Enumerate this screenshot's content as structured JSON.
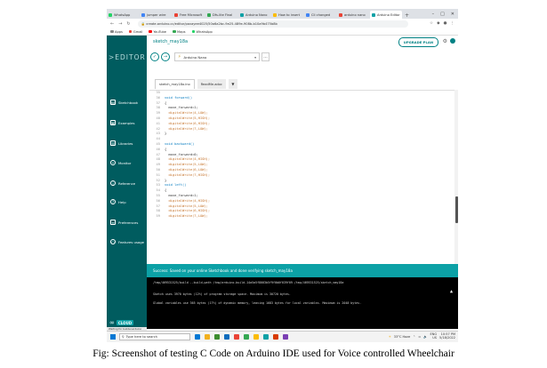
{
  "browser": {
    "tabs": [
      {
        "label": "WhatsApp",
        "color": "#25d366",
        "active": false
      },
      {
        "label": "jumper wire",
        "color": "#4285f4",
        "active": false
      },
      {
        "label": "Free Microsoft",
        "color": "#ea4335",
        "active": false
      },
      {
        "label": "Dfs-lite Final",
        "color": "#34a853",
        "active": false
      },
      {
        "label": "Arduino Nano",
        "color": "#0ca1a6",
        "active": false
      },
      {
        "label": "How to insert",
        "color": "#fbbc05",
        "active": false
      },
      {
        "label": "Cli changed",
        "color": "#4285f4",
        "active": false
      },
      {
        "label": "arduino nano",
        "color": "#ea4335",
        "active": false
      },
      {
        "label": "Arduino Editor",
        "color": "#0ca1a6",
        "active": true
      }
    ],
    "new_tab": "+",
    "url": "create.arduino.cc/editor/pavayee4025/50a6a2bc-9e25-489e-908b-b10a9b475b8b",
    "bookmarks": [
      {
        "label": "Apps",
        "color": "#888888"
      },
      {
        "label": "Gmail",
        "color": "#ea4335"
      },
      {
        "label": "YouTube",
        "color": "#ff0000"
      },
      {
        "label": "Maps",
        "color": "#34a853"
      },
      {
        "label": "WhatsApp",
        "color": "#25d366"
      }
    ]
  },
  "sidebar": {
    "logo": "EDITOR",
    "items": [
      {
        "label": "Sketchbook",
        "icon": "sketchbook-icon"
      },
      {
        "label": "Examples",
        "icon": "examples-icon"
      },
      {
        "label": "Libraries",
        "icon": "libraries-icon"
      },
      {
        "label": "Monitor",
        "icon": "monitor-icon"
      },
      {
        "label": "Reference",
        "icon": "reference-icon"
      },
      {
        "label": "Help",
        "icon": "help-icon"
      },
      {
        "label": "Preferences",
        "icon": "preferences-icon"
      },
      {
        "label": "Features usage",
        "icon": "features-usage-icon"
      }
    ],
    "cloud_label": "CLOUD",
    "status_text": "Waiting for builder.arduino"
  },
  "header": {
    "sketch_name": "sketch_may18a",
    "upgrade_label": "UPGRADE PLAN"
  },
  "toolbar": {
    "board": "Arduino Nano",
    "more": "..."
  },
  "editor": {
    "tabs": [
      {
        "label": "sketch_may18a.ino",
        "active": true
      },
      {
        "label": "ReadMe.adoc",
        "active": false
      }
    ],
    "lines": [
      {
        "n": "35",
        "code": ""
      },
      {
        "n": "36",
        "code": "void forward()"
      },
      {
        "n": "37",
        "code": "{"
      },
      {
        "n": "38",
        "code": "  move_forward=1;"
      },
      {
        "n": "39",
        "code": "  digitalWrite(4,LOW);"
      },
      {
        "n": "40",
        "code": "  digitalWrite(5,HIGH);"
      },
      {
        "n": "41",
        "code": "  digitalWrite(6,HIGH);"
      },
      {
        "n": "42",
        "code": "  digitalWrite(7,LOW);"
      },
      {
        "n": "43",
        "code": "}"
      },
      {
        "n": "44",
        "code": ""
      },
      {
        "n": "45",
        "code": "void backward()"
      },
      {
        "n": "46",
        "code": "{"
      },
      {
        "n": "47",
        "code": "  move_forward=0;"
      },
      {
        "n": "48",
        "code": "  digitalWrite(4,HIGH);"
      },
      {
        "n": "49",
        "code": "  digitalWrite(5,LOW);"
      },
      {
        "n": "50",
        "code": "  digitalWrite(6,LOW);"
      },
      {
        "n": "51",
        "code": "  digitalWrite(7,HIGH);"
      },
      {
        "n": "52",
        "code": "}"
      },
      {
        "n": "53",
        "code": "void left()"
      },
      {
        "n": "54",
        "code": "{"
      },
      {
        "n": "55",
        "code": "  move_forward=1;"
      },
      {
        "n": "56",
        "code": "  digitalWrite(4,HIGH);"
      },
      {
        "n": "57",
        "code": "  digitalWrite(5,LOW);"
      },
      {
        "n": "58",
        "code": "  digitalWrite(6,HIGH);"
      },
      {
        "n": "59",
        "code": "  digitalWrite(7,LOW);"
      }
    ]
  },
  "status": {
    "success": "Success: Saved on your online Sketchbook and done verifying sketch_may18a"
  },
  "console": {
    "lines": [
      "/tmp/469531525/build --build-path /tmp/arduino-build-14a5a5f8003b5f9f0b0f039f09 /tmp/469531525/sketch_may18a",
      "Sketch uses 3970 bytes (12%) of program storage space. Maximum is 30720 bytes.",
      "Global variables use 365 bytes (17%) of dynamic memory, leaving 1683 bytes for local variables. Maximum is 2048 bytes."
    ]
  },
  "taskbar": {
    "search_placeholder": "Type here to search",
    "weather": "33°C Haze",
    "lang": "ENG",
    "region": "US",
    "time": "10:57 PM",
    "date": "5/18/2022",
    "apps": [
      "#0078d4",
      "#f2b01e",
      "#3c8d2f",
      "#0f6cbd",
      "#ea4335",
      "#34a853",
      "#fbbc05",
      "#0ca1a6",
      "#d83b01",
      "#7b3fb3"
    ]
  },
  "caption": "Fig: Screenshot of testing C Code on Arduino IDE used for Voice controlled Wheelchair"
}
